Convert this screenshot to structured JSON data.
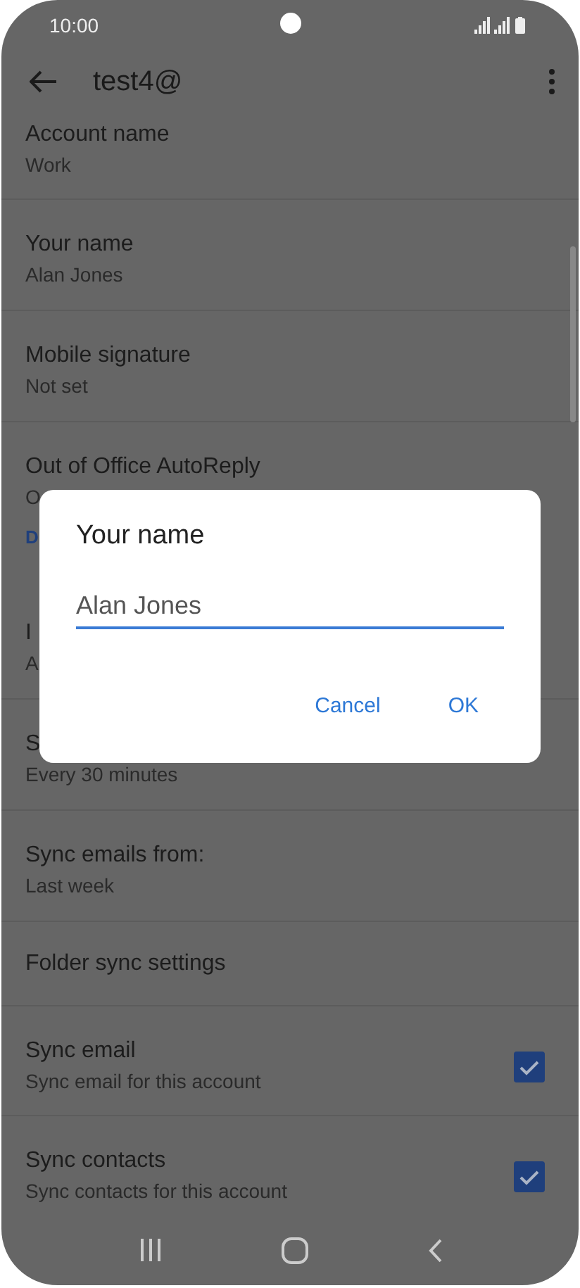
{
  "status_bar": {
    "time": "10:00"
  },
  "toolbar": {
    "title": "test4@"
  },
  "settings": [
    {
      "kind": "item",
      "title": "Account name",
      "subtitle": "Work"
    },
    {
      "kind": "item",
      "title": "Your name",
      "subtitle": "Alan Jones"
    },
    {
      "kind": "item",
      "title": "Mobile signature",
      "subtitle": "Not set"
    },
    {
      "kind": "item",
      "title": "Out of Office AutoReply",
      "subtitle": "O"
    },
    {
      "kind": "header",
      "title": "D"
    },
    {
      "kind": "item",
      "title": "I",
      "subtitle": "A"
    },
    {
      "kind": "item",
      "title": "S",
      "subtitle": "Every 30 minutes"
    },
    {
      "kind": "item",
      "title": "Sync emails from:",
      "subtitle": "Last week"
    },
    {
      "kind": "item",
      "title": "Folder sync settings"
    },
    {
      "kind": "check",
      "title": "Sync email",
      "subtitle": "Sync email for this account",
      "checked": true
    },
    {
      "kind": "check",
      "title": "Sync contacts",
      "subtitle": "Sync contacts for this account",
      "checked": true
    }
  ],
  "dialog": {
    "title": "Your name",
    "value": "Alan Jones",
    "buttons": [
      "Cancel",
      "OK"
    ]
  }
}
